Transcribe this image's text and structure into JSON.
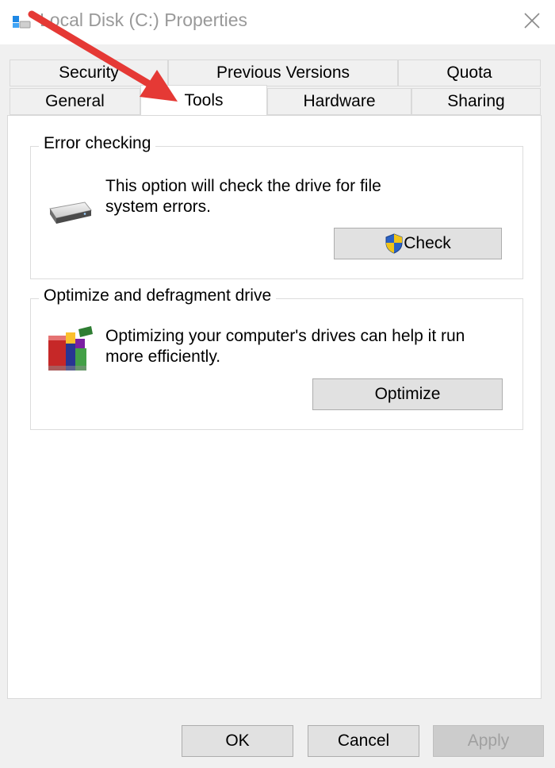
{
  "window": {
    "title": "Local Disk (C:) Properties"
  },
  "tabs": {
    "row_top": [
      {
        "label": "Security"
      },
      {
        "label": "Previous Versions"
      },
      {
        "label": "Quota"
      }
    ],
    "row_bottom": [
      {
        "label": "General"
      },
      {
        "label": "Tools",
        "active": true
      },
      {
        "label": "Hardware"
      },
      {
        "label": "Sharing"
      }
    ]
  },
  "error_checking": {
    "title": "Error checking",
    "description_line1": "This option will check the drive for file",
    "description_line2": "system errors.",
    "button_label": "Check",
    "icon": "drive-icon",
    "button_icon": "uac-shield-icon"
  },
  "optimize": {
    "title": "Optimize and defragment drive",
    "description_line1": "Optimizing your computer's drives can help it run",
    "description_line2": "more efficiently.",
    "button_label": "Optimize",
    "icon": "defrag-icon"
  },
  "footer": {
    "ok_label": "OK",
    "cancel_label": "Cancel",
    "apply_label": "Apply",
    "apply_disabled": true
  },
  "annotation": {
    "arrow_color": "#e53935"
  }
}
